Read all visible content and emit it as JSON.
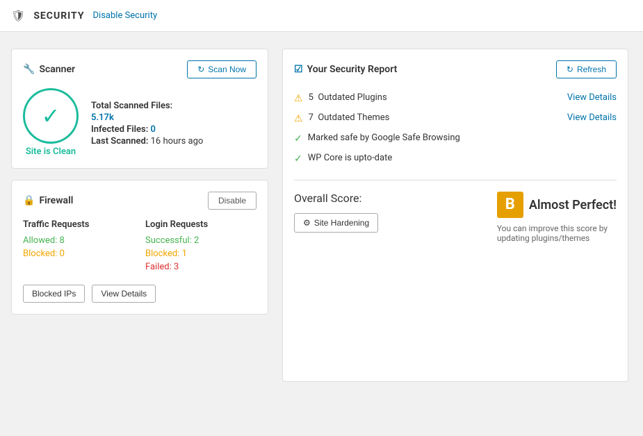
{
  "header": {
    "title": "SECURITY",
    "disable_link": "Disable Security"
  },
  "scanner": {
    "card_title": "Scanner",
    "scan_button": "Scan Now",
    "total_scanned_label": "Total Scanned Files:",
    "total_scanned_value": "5.17k",
    "infected_label": "Infected Files:",
    "infected_value": "0",
    "last_scanned_label": "Last Scanned:",
    "last_scanned_value": "16 hours ago",
    "site_clean_label": "Site is Clean"
  },
  "firewall": {
    "card_title": "Firewall",
    "disable_button": "Disable",
    "traffic_title": "Traffic Requests",
    "allowed_label": "Allowed:",
    "allowed_value": "8",
    "blocked_label": "Blocked:",
    "blocked_value": "0",
    "login_title": "Login Requests",
    "successful_label": "Successful:",
    "successful_value": "2",
    "login_blocked_label": "Blocked:",
    "login_blocked_value": "1",
    "failed_label": "Failed:",
    "failed_value": "3",
    "blocked_ips_button": "Blocked IPs",
    "view_details_button": "View Details"
  },
  "security_report": {
    "card_title": "Your Security Report",
    "refresh_button": "Refresh",
    "items": [
      {
        "type": "warning",
        "text": "5  Outdated Plugins",
        "link": "View Details"
      },
      {
        "type": "warning",
        "text": "7  Outdated Themes",
        "link": "View Details"
      },
      {
        "type": "check",
        "text": "Marked safe by Google Safe Browsing",
        "link": ""
      },
      {
        "type": "check",
        "text": "WP Core is upto-date",
        "link": ""
      }
    ]
  },
  "overall_score": {
    "title": "Overall Score:",
    "grade": "B",
    "grade_label": "Almost Perfect!",
    "description": "You can improve this score by updating plugins/themes",
    "site_hardening_button": "Site Hardening"
  }
}
